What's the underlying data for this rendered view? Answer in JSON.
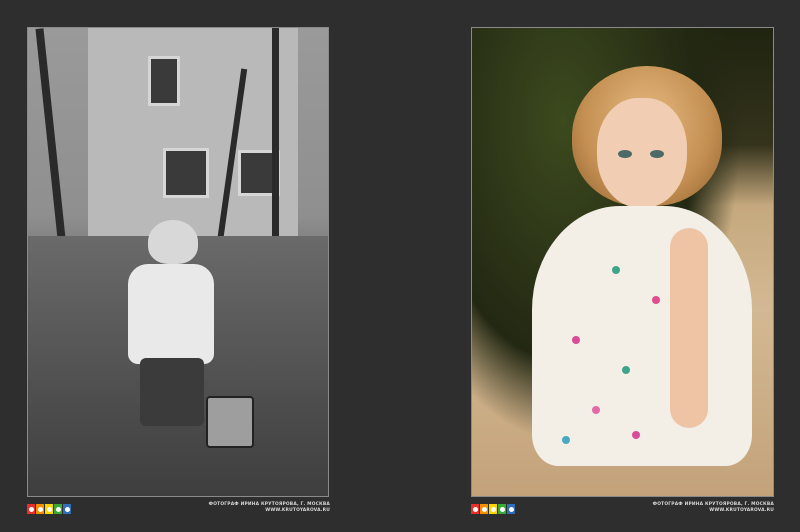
{
  "left_page": {
    "photo": "black-and-white photo of a small child in a hooded coat pulling a toy truck along a path past a building",
    "credit_line1": "ФОТОГРАФ ИРИНА КРУТОЯРОВА, Г. МОСКВА",
    "credit_line2": "WWW.KRUTOYAROVA.RU"
  },
  "right_page": {
    "photo": "colour photo of a curly-haired little girl in a floral white dress sitting outdoors",
    "credit_line1": "ФОТОГРАФ ИРИНА КРУТОЯРОВА, Г. МОСКВА",
    "credit_line2": "WWW.KRUTOYAROVA.RU"
  },
  "logo_colors": [
    "#e4312b",
    "#f39200",
    "#ffd500",
    "#3aa935",
    "#2f6fb7"
  ],
  "colors": {
    "background": "#2e2e2e",
    "frame_border": "#8a8a8a",
    "credit_text": "#d9d9d9"
  }
}
